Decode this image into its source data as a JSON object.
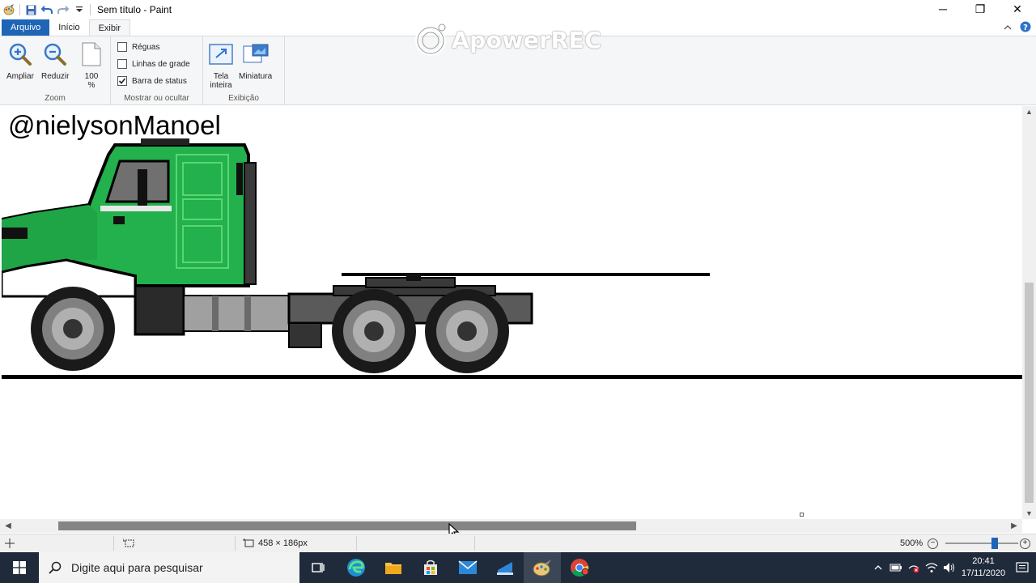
{
  "window": {
    "title": "Sem título - Paint",
    "controls": {
      "minimize": "─",
      "restore": "❐",
      "close": "✕"
    }
  },
  "tabs": [
    {
      "label": "Arquivo"
    },
    {
      "label": "Início"
    },
    {
      "label": "Exibir"
    }
  ],
  "ribbon": {
    "zoom_group": {
      "label": "Zoom",
      "zoom_in": "Ampliar",
      "zoom_out": "Reduzir",
      "hundred_line1": "100",
      "hundred_line2": "%"
    },
    "show_group": {
      "label": "Mostrar ou ocultar",
      "rulers": {
        "label": "Réguas",
        "checked": false
      },
      "gridlines": {
        "label": "Linhas de grade",
        "checked": false
      },
      "statusbar": {
        "label": "Barra de status",
        "checked": true
      }
    },
    "display_group": {
      "label": "Exibição",
      "fullscreen_line1": "Tela",
      "fullscreen_line2": "inteira",
      "thumbnail": "Miniatura"
    }
  },
  "watermark": {
    "text": "ApowerREC"
  },
  "canvas": {
    "author_text": "@nielysonManoel",
    "colors": {
      "cab_green": "#22b14c",
      "cab_light_green": "#5ad672",
      "outline": "#000000",
      "chassis_dark": "#3a3a3a",
      "chassis_mid": "#5a5a5a",
      "tank_gray": "#a0a0a0",
      "wheel_dark": "#1a1a1a",
      "wheel_gray": "#808080"
    }
  },
  "statusbar": {
    "dimensions": "458 × 186px",
    "zoom_level": "500%",
    "zoom_fraction": 0.63
  },
  "taskbar": {
    "search_placeholder": "Digite aqui para pesquisar",
    "time": "20:41",
    "date": "17/11/2020"
  }
}
